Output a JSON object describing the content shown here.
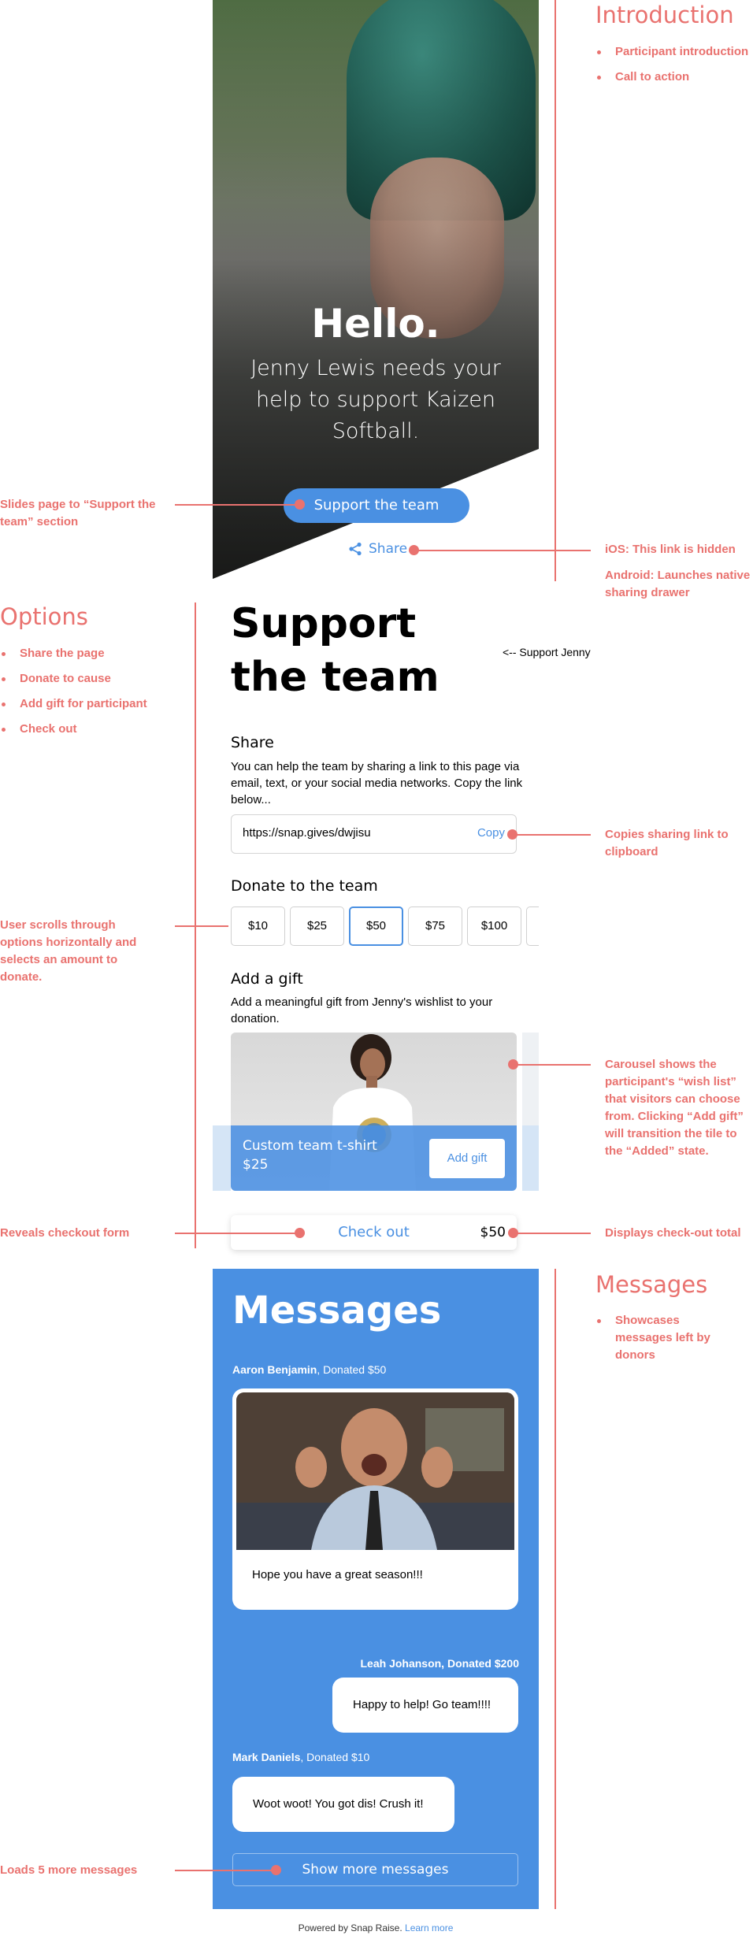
{
  "hero": {
    "hello": "Hello.",
    "subtitle": "Jenny Lewis needs your help to support Kaizen Softball.",
    "cta_label": "Support the team",
    "share_label": "Share"
  },
  "support": {
    "title": "Support the team",
    "side_label": "<-- Support Jenny",
    "share_heading": "Share",
    "share_text": "You can help the team by sharing a link to this page via email, text, or your social media networks. Copy the link below...",
    "share_url": "https://snap.gives/dwjisu",
    "copy_label": "Copy",
    "donate_heading": "Donate to the team",
    "amounts": [
      "$10",
      "$25",
      "$50",
      "$75",
      "$100"
    ],
    "selected_amount": "$50",
    "gift_heading": "Add a gift",
    "gift_text": "Add a meaningful gift from Jenny's wishlist to your donation.",
    "gift_name": "Custom team t-shirt",
    "gift_price": "$25",
    "add_gift_label": "Add gift",
    "checkout_label": "Check out",
    "checkout_total": "$50"
  },
  "messages": {
    "title": "Messages",
    "items": [
      {
        "name": "Aaron Benjamin",
        "donation": ", Donated $50",
        "text": "Hope you have a great season!!!"
      },
      {
        "name": "Leah Johanson, Donated $200",
        "text": "Happy to help! Go team!!!!"
      },
      {
        "name": "Mark Daniels",
        "donation": ", Donated $10",
        "text": "Woot woot! You got dis! Crush it!"
      }
    ],
    "show_more_label": "Show more messages"
  },
  "footer": {
    "powered": "Powered by Snap Raise.",
    "learn_more": "Learn more"
  },
  "annotations": {
    "intro_title": "Introduction",
    "intro_items": [
      "Participant introduction",
      "Call to action"
    ],
    "slides_note": "Slides page to “Support the team” section",
    "ios_note": "iOS: This link is hidden",
    "android_note": "Android: Launches native sharing drawer",
    "options_title": "Options",
    "options_items": [
      "Share the page",
      "Donate to cause",
      "Add gift for participant",
      "Check out"
    ],
    "copy_note": "Copies sharing link to clipboard",
    "scroll_note": "User scrolls through options horizontally and selects an amount to donate.",
    "carousel_note": "Carousel shows the participant's “wish list” that visitors can choose from. Clicking “Add gift” will transition the tile to the “Added” state.",
    "checkout_note": "Reveals checkout form",
    "total_note": "Displays check-out total",
    "messages_title": "Messages",
    "messages_items": [
      "Showcases messages left by donors"
    ],
    "loads_note": "Loads 5 more messages"
  },
  "colors": {
    "accent": "#4a90e2",
    "annotation": "#e9726f"
  }
}
